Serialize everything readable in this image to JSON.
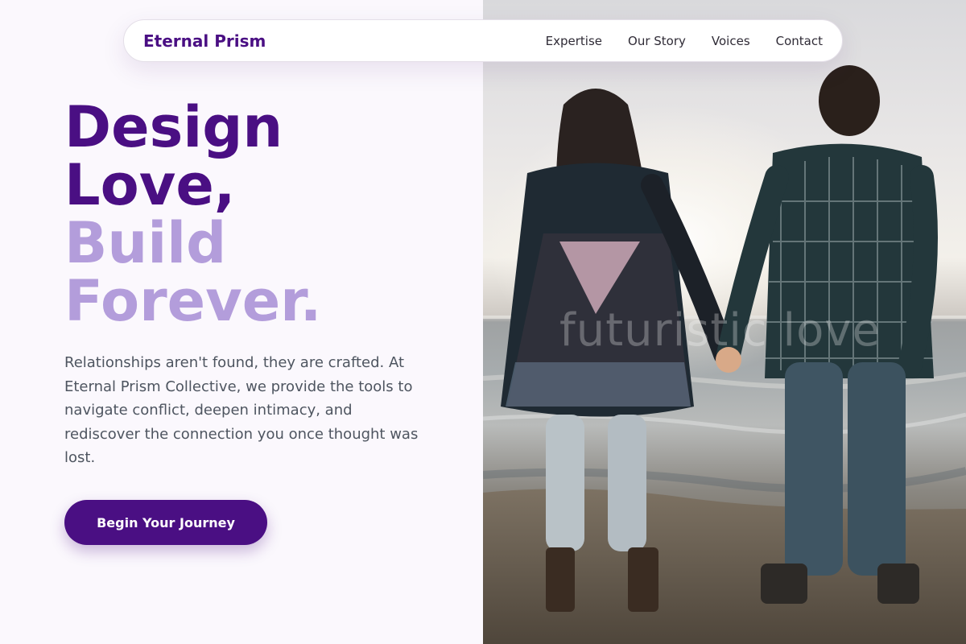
{
  "nav": {
    "brand": "Eternal Prism",
    "links": [
      "Expertise",
      "Our Story",
      "Voices",
      "Contact"
    ]
  },
  "hero": {
    "headline_lines_dark": [
      "Design",
      "Love,"
    ],
    "headline_lines_light": [
      "Build",
      "Forever."
    ],
    "intro": "Relationships aren't found, they are crafted. At Eternal Prism Collective, we provide the tools to navigate conflict, deepen intimacy, and rediscover the connection you once thought was lost.",
    "cta_label": "Begin Your Journey"
  },
  "photo": {
    "caption": "futuristic love",
    "subject": "couple holding hands facing the ocean"
  },
  "colors": {
    "brand": "#4a0f83",
    "accent_light": "#b39ddb",
    "body_text": "#4e5560",
    "background": "#fbf8fd"
  }
}
